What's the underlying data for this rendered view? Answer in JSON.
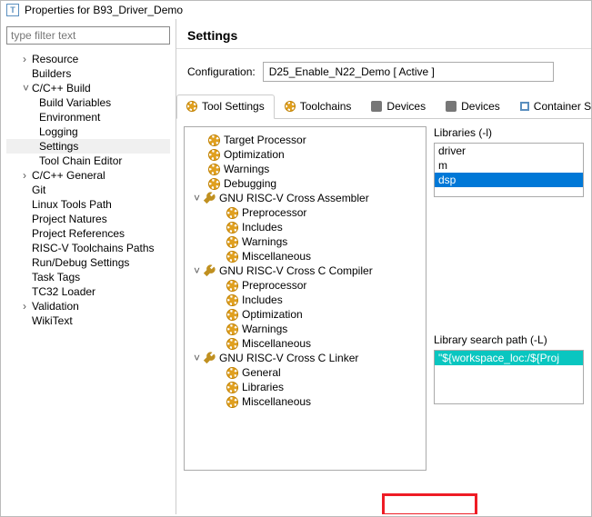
{
  "window": {
    "title": "Properties for B93_Driver_Demo"
  },
  "filter_placeholder": "type filter text",
  "left_tree": {
    "resource": "Resource",
    "builders": "Builders",
    "cbuild": "C/C++ Build",
    "build_vars": "Build Variables",
    "environment": "Environment",
    "logging": "Logging",
    "settings": "Settings",
    "tool_chain_editor": "Tool Chain Editor",
    "cgeneral": "C/C++ General",
    "git": "Git",
    "linux_tools_path": "Linux Tools Path",
    "project_natures": "Project Natures",
    "project_references": "Project References",
    "riscv_toolchains": "RISC-V Toolchains Paths",
    "run_debug": "Run/Debug Settings",
    "task_tags": "Task Tags",
    "tc32_loader": "TC32 Loader",
    "validation": "Validation",
    "wikitext": "WikiText"
  },
  "right": {
    "heading": "Settings",
    "config_label": "Configuration:",
    "config_value": "D25_Enable_N22_Demo  [ Active ]"
  },
  "tabs": {
    "tool_settings": "Tool Settings",
    "toolchains": "Toolchains",
    "devices1": "Devices",
    "devices2": "Devices",
    "containers": "Container S"
  },
  "tool_tree": {
    "target_processor": "Target Processor",
    "optimization": "Optimization",
    "warnings": "Warnings",
    "debugging": "Debugging",
    "asm": "GNU RISC-V Cross Assembler",
    "asm_prep": "Preprocessor",
    "asm_inc": "Includes",
    "asm_warn": "Warnings",
    "asm_misc": "Miscellaneous",
    "cc": "GNU RISC-V Cross C Compiler",
    "cc_prep": "Preprocessor",
    "cc_inc": "Includes",
    "cc_opt": "Optimization",
    "cc_warn": "Warnings",
    "cc_misc": "Miscellaneous",
    "ld": "GNU RISC-V Cross C Linker",
    "ld_general": "General",
    "ld_libraries": "Libraries",
    "ld_misc": "Miscellaneous"
  },
  "libraries": {
    "label": "Libraries (-l)",
    "items": {
      "i0": "driver",
      "i1": "m",
      "i2": "dsp"
    }
  },
  "search_path": {
    "label": "Library search path (-L)",
    "items": {
      "i0": "\"${workspace_loc:/${Proj"
    }
  }
}
